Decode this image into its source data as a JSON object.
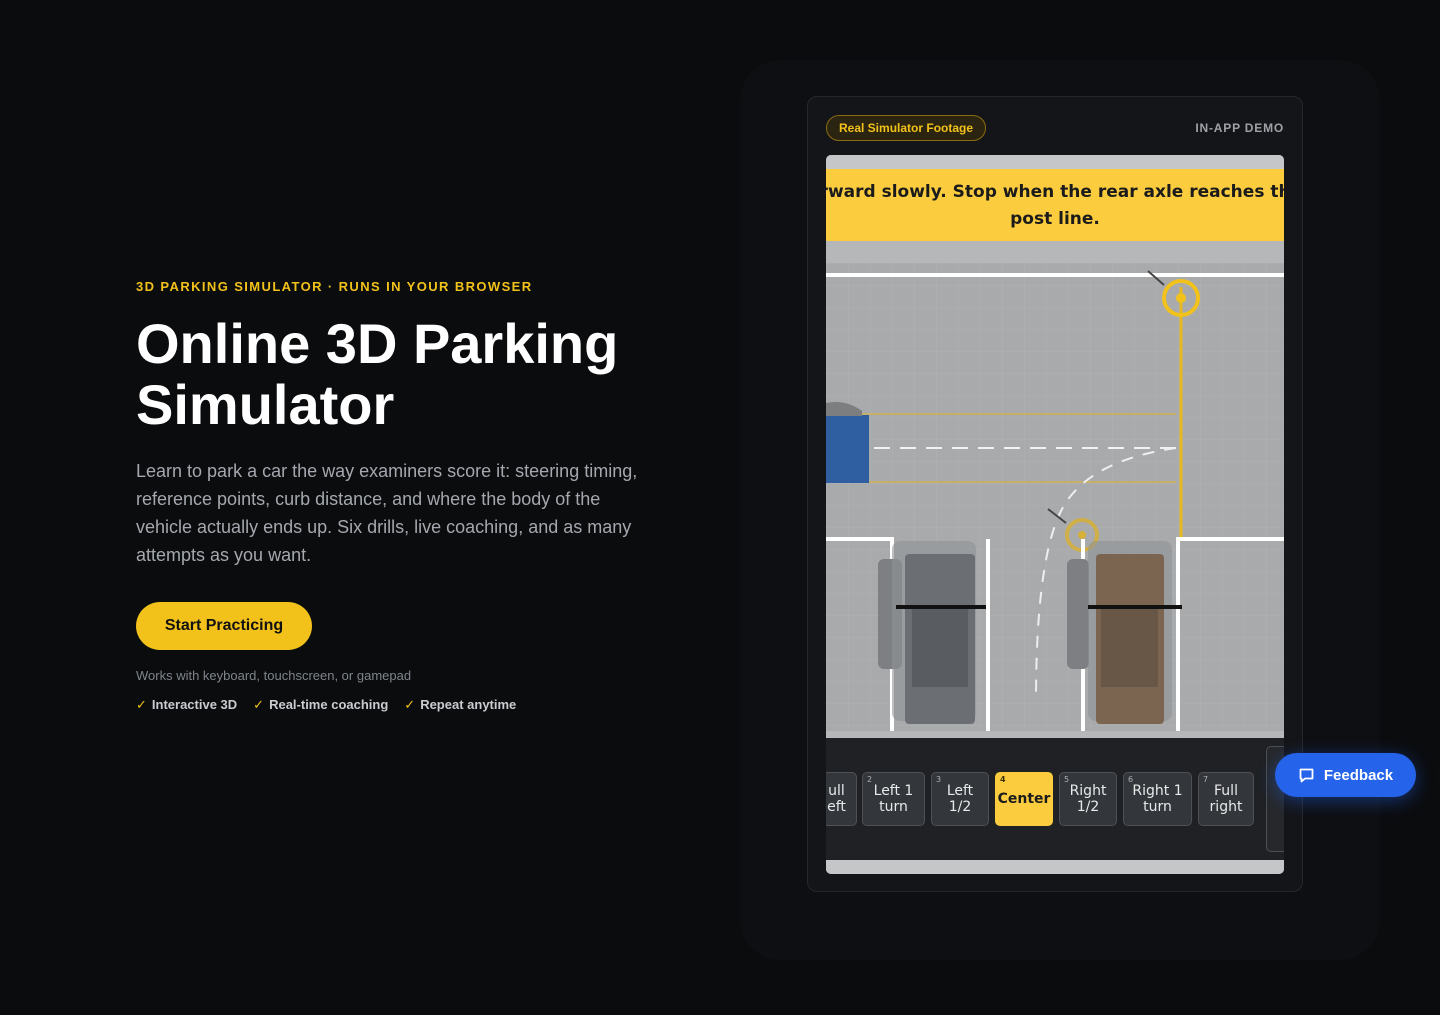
{
  "hero": {
    "eyebrow": "3D PARKING SIMULATOR · RUNS IN YOUR BROWSER",
    "title": "Online 3D Parking Simulator",
    "description": "Learn to park a car the way examiners score it: steering timing, reference points, curb distance, and where the body of the vehicle actually ends up. Six drills, live coaching, and as many attempts as you want.",
    "cta_label": "Start Practicing",
    "input_note": "Works with keyboard, touchscreen, or gamepad",
    "features": [
      "Interactive 3D",
      "Real-time coaching",
      "Repeat anytime"
    ],
    "check_glyph": "✓"
  },
  "demo": {
    "badge": "Real Simulator Footage",
    "label": "IN-APP DEMO",
    "banner_line1": "orward slowly. Stop when the rear axle reaches the",
    "banner_line2": "post line.",
    "steering": [
      {
        "num": "",
        "label": "ull\neft",
        "active": false
      },
      {
        "num": "2",
        "label": "Left 1\nturn",
        "active": false
      },
      {
        "num": "3",
        "label": "Left\n1/2",
        "active": false
      },
      {
        "num": "4",
        "label": "Center",
        "active": true
      },
      {
        "num": "5",
        "label": "Right\n1/2",
        "active": false
      },
      {
        "num": "6",
        "label": "Right 1\nturn",
        "active": false
      },
      {
        "num": "7",
        "label": "Full\nright",
        "active": false
      }
    ]
  },
  "feedback": {
    "label": "Feedback",
    "icon": "chat-bubble-icon"
  },
  "colors": {
    "accent": "#f2c21b",
    "banner": "#fbcd3e",
    "feedback": "#2563eb",
    "background": "#0b0c0e"
  }
}
